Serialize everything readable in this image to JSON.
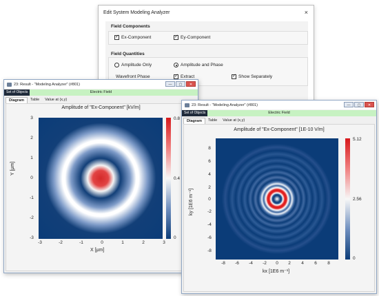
{
  "dialog": {
    "title": "Edit System Modeling Analyzer",
    "close": "×",
    "field_components_label": "Field Components",
    "ex_component": "Ex-Component",
    "ey_component": "Ey-Component",
    "field_quantities_label": "Field Quantities",
    "amplitude_only": "Amplitude Only",
    "amplitude_and_phase": "Amplitude and Phase",
    "wavefront_phase_label": "Wavefront Phase",
    "extract": "Extract",
    "show_separately": "Show Separately"
  },
  "window_left": {
    "title": "23: Result - \"Modeling Analyzer\" (#801)",
    "set_of_objects": "Set of Objects",
    "electric_field": "Electric Field",
    "tabs": [
      "Diagram",
      "Table",
      "Value at (x,y)"
    ],
    "plot_title": "Amplitude of \"Ex-Component\"  [kV/m]",
    "x_ticks": [
      "-3",
      "-2",
      "-1",
      "0",
      "1",
      "2",
      "3"
    ],
    "y_ticks": [
      "3",
      "2",
      "1",
      "0",
      "-1",
      "-2",
      "-3"
    ],
    "x_label": "X [µm]",
    "y_label": "Y [µm]",
    "cbar_ticks": [
      "0.8",
      "0.4",
      "0"
    ]
  },
  "window_right": {
    "title": "23: Result - \"Modeling Analyzer\" (#801)",
    "set_of_objects": "Set of Objects",
    "electric_field": "Electric Field",
    "tabs": [
      "Diagram",
      "Table",
      "Value at (x,y)"
    ],
    "plot_title": "Amplitude of \"Ex-Component\"  [1E-10 V/m]",
    "x_ticks": [
      "-8",
      "-6",
      "-4",
      "-2",
      "0",
      "2",
      "4",
      "6",
      "8"
    ],
    "y_ticks": [
      "8",
      "6",
      "4",
      "2",
      "0",
      "-2",
      "-4",
      "-6",
      "-8"
    ],
    "x_label": "kx [1E6 m⁻¹]",
    "y_label": "ky [1E6 m⁻¹]",
    "cbar_ticks": [
      "5.12",
      "2.56",
      "0"
    ]
  },
  "window_buttons": {
    "minimize": "—",
    "maximize": "▢",
    "close": "✕"
  }
}
